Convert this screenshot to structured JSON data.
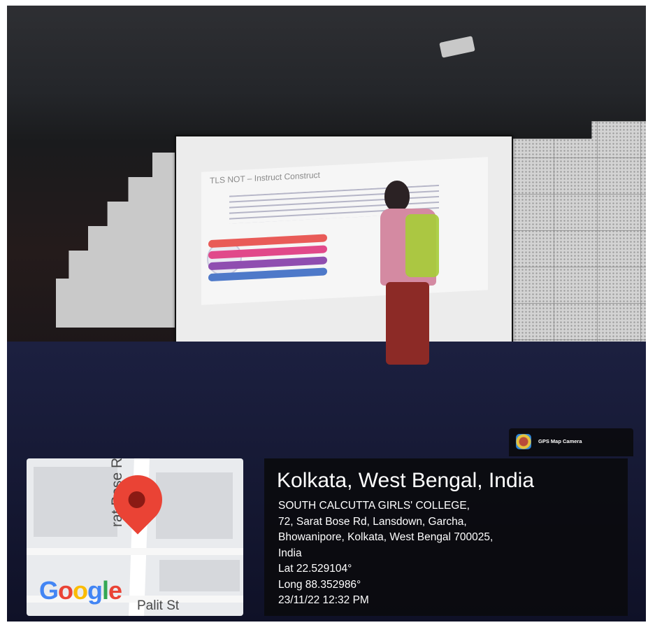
{
  "badge": {
    "app_name": "GPS Map Camera",
    "icon": "gps-map-camera-icon"
  },
  "map": {
    "street_vertical": "rat Bose R",
    "street_horizontal": "Palit St",
    "logo": "Google",
    "pin_icon": "map-pin-icon"
  },
  "location": {
    "title": "Kolkata, West Bengal, India",
    "address_lines": [
      "SOUTH CALCUTTA GIRLS' COLLEGE,",
      "72, Sarat Bose Rd, Lansdown, Garcha,",
      "Bhowanipore, Kolkata, West Bengal 700025,",
      "India"
    ],
    "lat": "Lat 22.529104°",
    "long": "Long 88.352986°",
    "datetime": "23/11/22 12:32 PM"
  },
  "slide": {
    "title": "TLS NOT – Instruct Construct"
  }
}
